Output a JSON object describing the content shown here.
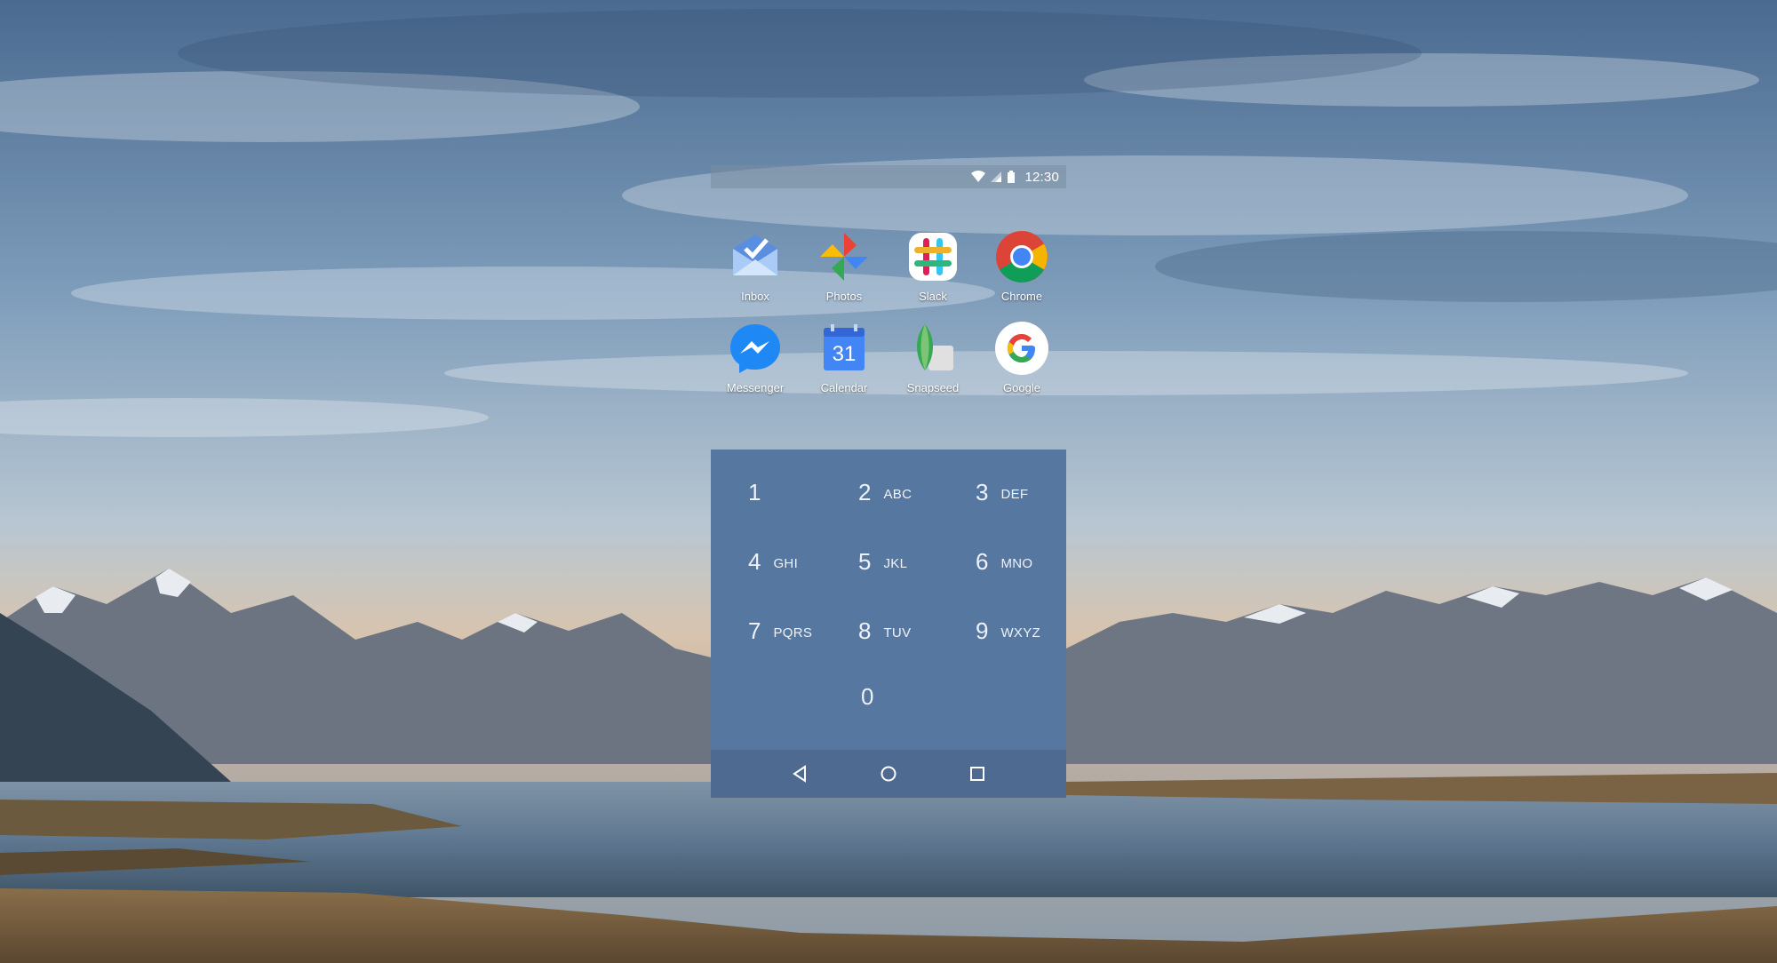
{
  "status_bar": {
    "time": "12:30",
    "icons": [
      "wifi-icon",
      "cell-signal-icon",
      "battery-icon"
    ]
  },
  "apps": [
    {
      "label": "Inbox",
      "icon": "inbox-icon"
    },
    {
      "label": "Photos",
      "icon": "photos-icon"
    },
    {
      "label": "Slack",
      "icon": "slack-icon"
    },
    {
      "label": "Chrome",
      "icon": "chrome-icon"
    },
    {
      "label": "Messenger",
      "icon": "messenger-icon"
    },
    {
      "label": "Calendar",
      "icon": "calendar-icon",
      "badge": "31"
    },
    {
      "label": "Snapseed",
      "icon": "snapseed-icon"
    },
    {
      "label": "Google",
      "icon": "google-icon"
    }
  ],
  "dialpad": {
    "keys": [
      {
        "digit": "1",
        "letters": ""
      },
      {
        "digit": "2",
        "letters": "ABC"
      },
      {
        "digit": "3",
        "letters": "DEF"
      },
      {
        "digit": "4",
        "letters": "GHI"
      },
      {
        "digit": "5",
        "letters": "JKL"
      },
      {
        "digit": "6",
        "letters": "MNO"
      },
      {
        "digit": "7",
        "letters": "PQRS"
      },
      {
        "digit": "8",
        "letters": "TUV"
      },
      {
        "digit": "9",
        "letters": "WXYZ"
      },
      {
        "digit": "0",
        "letters": ""
      }
    ]
  },
  "nav_bar": {
    "buttons": [
      "back-icon",
      "home-icon",
      "recents-icon"
    ]
  },
  "colors": {
    "dialpad_bg": "#5677a0",
    "navbar_bg": "#4e6a90",
    "status_bar_bg": "#788ca0"
  }
}
